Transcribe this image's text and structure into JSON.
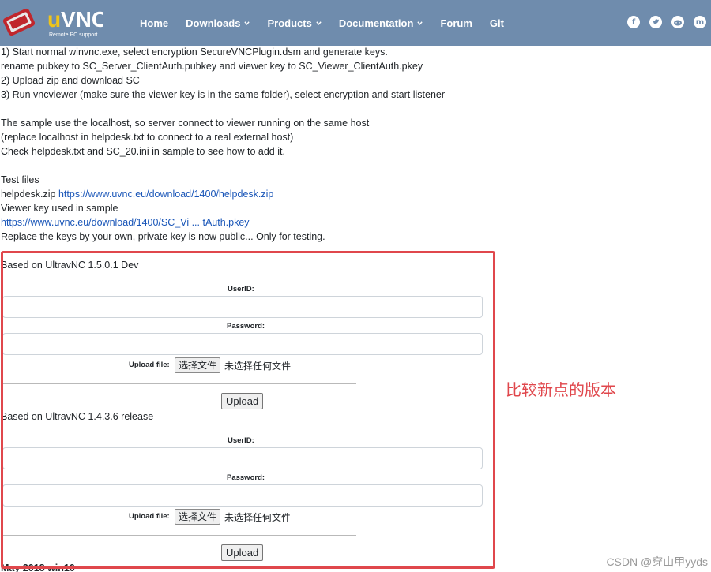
{
  "brand": {
    "logo_text": "uVNC",
    "logo_sub": "Remote PC support",
    "color": "#6f8cad"
  },
  "nav": {
    "items": [
      {
        "label": "Home",
        "has_dropdown": false
      },
      {
        "label": "Downloads",
        "has_dropdown": true
      },
      {
        "label": "Products",
        "has_dropdown": true
      },
      {
        "label": "Documentation",
        "has_dropdown": true
      },
      {
        "label": "Forum",
        "has_dropdown": false
      },
      {
        "label": "Git",
        "has_dropdown": false
      }
    ]
  },
  "social": [
    "facebook-icon",
    "twitter-icon",
    "reddit-icon",
    "mastodon-icon"
  ],
  "content": {
    "lines": [
      "1) Start normal winvnc.exe, select encryption SecureVNCPlugin.dsm and generate keys.",
      "rename pubkey to SC_Server_ClientAuth.pubkey and viewer key to SC_Viewer_ClientAuth.pkey",
      "2) Upload zip and download SC",
      "3) Run vncviewer (make sure the viewer key is in the same folder), select encryption and start listener",
      "The sample use the localhost, so server connect to viewer running on the same host",
      "(replace localhost in helpdesk.txt to connect to a real external host)",
      "Check helpdesk.txt and SC_20.ini in sample to see how to add it.",
      "Test files"
    ],
    "helpdesk_prefix": "helpdesk.zip ",
    "helpdesk_link": "https://www.uvnc.eu/download/1400/helpdesk.zip",
    "viewer_key_label": "Viewer key used in sample",
    "viewer_key_link": "https://www.uvnc.eu/download/1400/SC_Vi ... tAuth.pkey",
    "replace_note": "Replace the keys by your own, private key is now public... Only for testing."
  },
  "forms": [
    {
      "heading": "Based on UltravNC 1.5.0.1 Dev",
      "userid_label": "UserID:",
      "password_label": "Password:",
      "upload_label": "Upload file:",
      "file_button": "选择文件",
      "file_status": "未选择任何文件",
      "submit": "Upload"
    },
    {
      "heading": "Based on UltravNC 1.4.3.6 release",
      "userid_label": "UserID:",
      "password_label": "Password:",
      "upload_label": "Upload file:",
      "file_button": "选择文件",
      "file_status": "未选择任何文件",
      "submit": "Upload"
    }
  ],
  "footer_partial": "May 2018 win10",
  "annotation": {
    "text": "比较新点的版本",
    "color": "#e0474c"
  },
  "watermark": "CSDN @穿山甲yyds"
}
